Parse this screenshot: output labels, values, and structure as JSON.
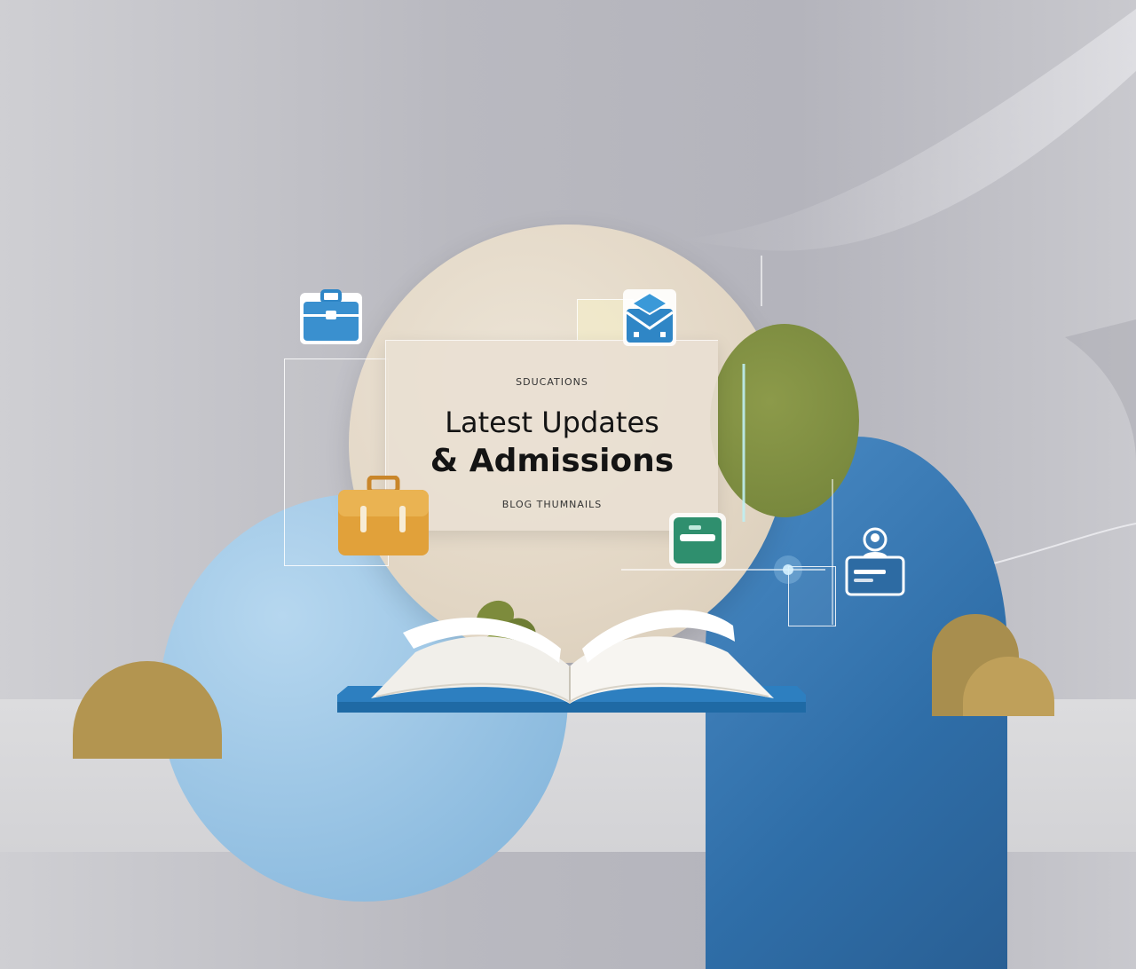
{
  "card": {
    "kicker": "SDUCATIONS",
    "title_line1": "Latest Updates",
    "title_line2": "& Admissions",
    "footer": "BLOG THUMNAILS"
  },
  "icons": {
    "briefcase_blue": "briefcase-icon",
    "briefcase_yellow": "briefcase-icon",
    "graduation_envelope": "graduation-cap-icon",
    "message_card": "message-card-icon",
    "user_id": "user-id-card-icon",
    "book": "open-book-icon"
  },
  "colors": {
    "blue_accent": "#3a8fd0",
    "olive": "#7a8a3e",
    "tan": "#b39550",
    "teal": "#2f8f6e",
    "yellow": "#e0a63a"
  }
}
